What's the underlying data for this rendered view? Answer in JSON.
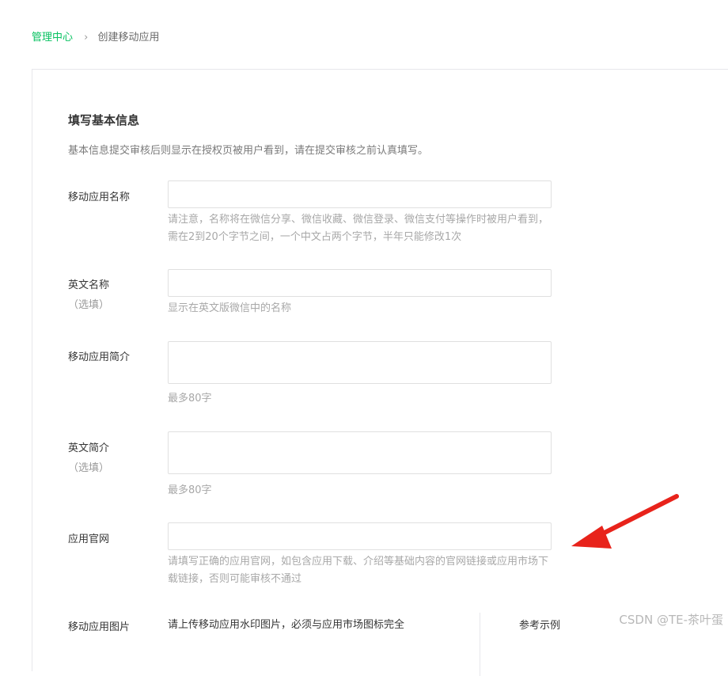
{
  "breadcrumb": {
    "parent": "管理中心",
    "separator": "›",
    "current": "创建移动应用"
  },
  "section": {
    "title": "填写基本信息",
    "description": "基本信息提交审核后则显示在授权页被用户看到，请在提交审核之前认真填写。"
  },
  "fields": {
    "app_name": {
      "label": "移动应用名称",
      "value": "",
      "tip_line1": "请注意，名称将在微信分享、微信收藏、微信登录、微信支付等操作时被用户看到，",
      "tip_line2": "需在2到20个字节之间，一个中文占两个字节，半年只能修改1次"
    },
    "english_name": {
      "label": "英文名称",
      "optional": "（选填）",
      "value": "",
      "tip": "显示在英文版微信中的名称"
    },
    "app_intro": {
      "label": "移动应用简介",
      "value": "",
      "tip": "最多80字"
    },
    "english_intro": {
      "label": "英文简介",
      "optional": "（选填）",
      "value": "",
      "tip": "最多80字"
    },
    "website": {
      "label": "应用官网",
      "value": "",
      "tip_line1": "请填写正确的应用官网，如包含应用下载、介绍等基础内容的官网链接或应用市场下",
      "tip_line2": "载链接，否则可能审核不通过"
    },
    "app_image": {
      "label": "移动应用图片",
      "tip": "请上传移动应用水印图片，必须与应用市场图标完全",
      "example_label": "参考示例"
    }
  },
  "annotation": {
    "arrow_color": "#e8231b"
  },
  "colors": {
    "accent": "#07c160",
    "border": "#e0e0e0",
    "muted_text": "#a8a8a8"
  },
  "watermark": "CSDN @TE-茶叶蛋"
}
